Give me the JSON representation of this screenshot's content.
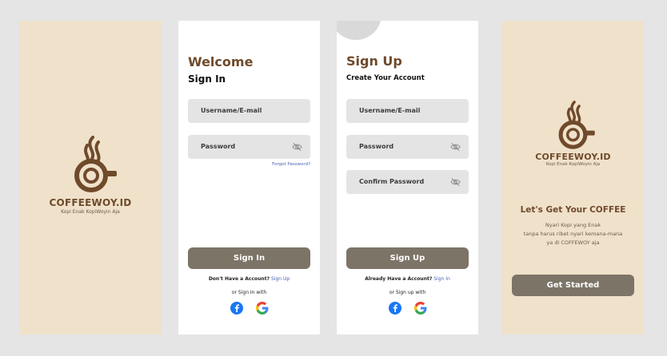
{
  "splash": {
    "brand_name": "COFFEEWOY.ID",
    "tagline": "Kopi Enak KopiWoyin Aja"
  },
  "signin": {
    "title": "Welcome",
    "subtitle": "Sign In",
    "username_placeholder": "Username/E-mail",
    "password_placeholder": "Password",
    "forgot_label": "Forgot Password?",
    "button_label": "Sign In",
    "no_account_text": "Don't Have a Account?",
    "signup_link": "Sign Up",
    "or_text": "or Sign In with"
  },
  "signup": {
    "title": "Sign Up",
    "subtitle": "Create Your Account",
    "username_placeholder": "Username/E-mail",
    "password_placeholder": "Password",
    "confirm_placeholder": "Confirm Password",
    "button_label": "Sign Up",
    "have_account_text": "Already Have a Account?",
    "signin_link": "Sign In",
    "or_text": "or Sign up with"
  },
  "onboarding": {
    "brand_name": "COFFEEWOY.ID",
    "tagline": "Kopi Enak KopiWoyin Aja",
    "headline": "Let's Get Your COFFEE",
    "desc_line1": "Nyari Kopi yang Enak",
    "desc_line2": "tanpa harus ribet nyari kemana-mana",
    "desc_line3": "ya di COFFEWOY aja",
    "button_label": "Get Started"
  },
  "colors": {
    "brand_brown": "#6f4a2b",
    "button_gray": "#7c7466",
    "cream": "#f0e1ca",
    "link_blue": "#4a63b8"
  },
  "icons": {
    "logo": "coffee-cup-steam-logo",
    "eye_off": "eye-off-icon",
    "facebook": "facebook-icon",
    "google": "google-icon"
  }
}
